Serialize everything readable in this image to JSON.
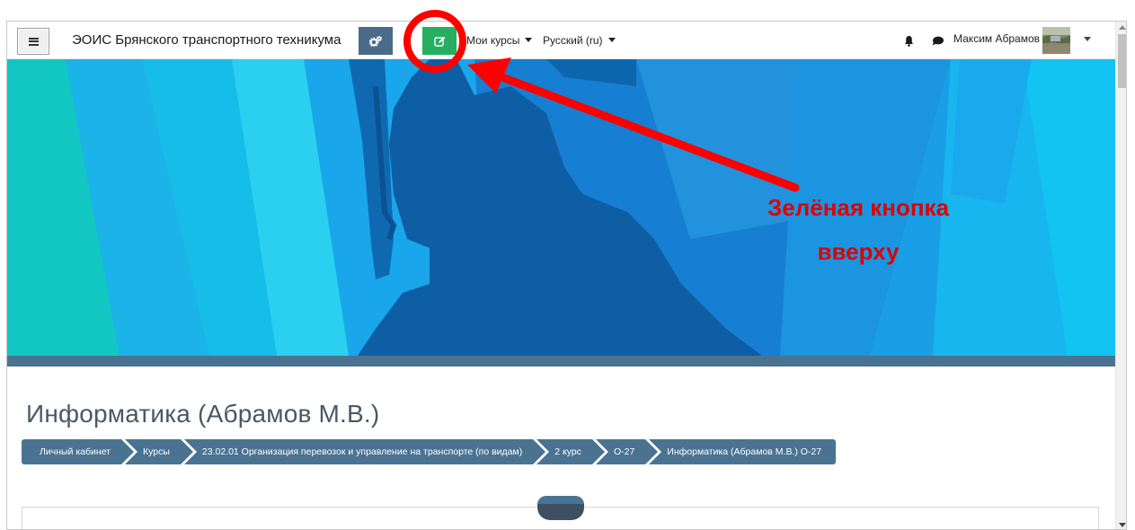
{
  "navbar": {
    "site_name": "ЭОИС Брянского транспортного техникума",
    "my_courses": "Мои курсы",
    "language": "Русский (ru)",
    "user_name": "Максим Абрамов",
    "icons": {
      "menu": "hamburger-menu-icon",
      "admin": "cogs-icon",
      "edit": "edit-pencil-icon",
      "notifications": "bell-icon",
      "messages": "chat-bubble-icon"
    }
  },
  "course": {
    "title": "Информатика (Абрамов М.В.)",
    "breadcrumb": [
      "Личный кабинет",
      "Курсы",
      "23.02.01 Организация перевозок и управление на транспорте (по видам)",
      "2 курс",
      "О-27",
      "Информатика (Абрамов М.В.) О-27"
    ]
  },
  "annotation": {
    "line1": "Зелёная кнопка",
    "line2": "вверху",
    "color": "#e00000"
  },
  "colors": {
    "edit_button": "#27ae60",
    "admin_button": "#4a6b8a",
    "breadcrumb": "#4a7392",
    "title_text": "#4a5866"
  }
}
